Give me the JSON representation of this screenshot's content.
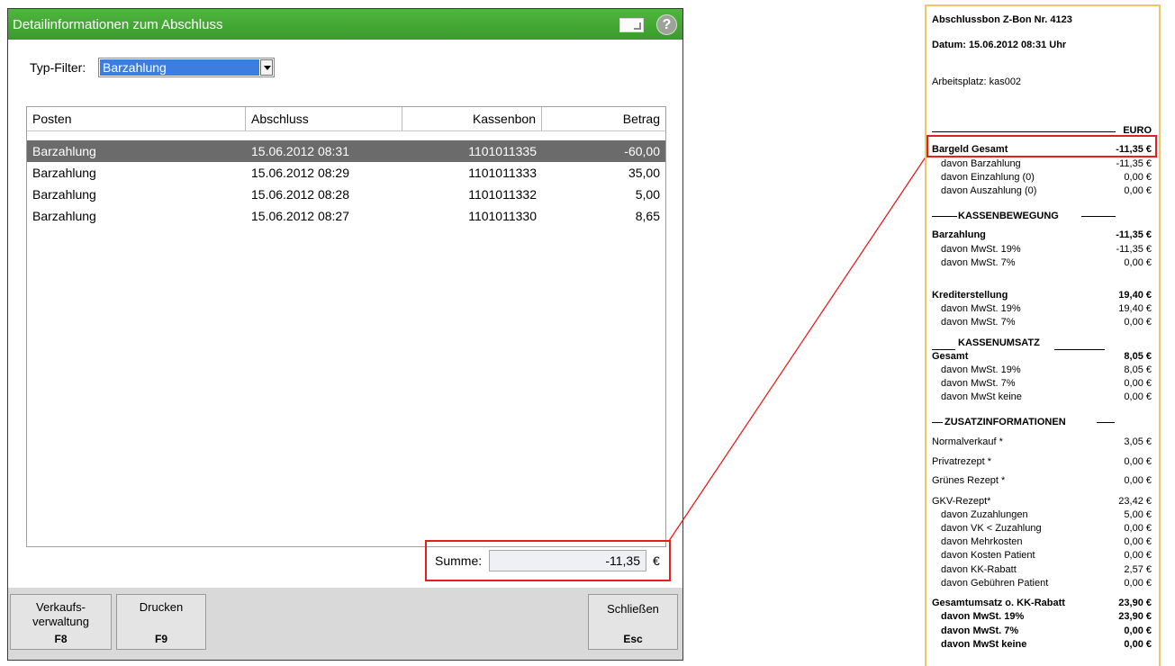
{
  "dialog": {
    "title": "Detailinformationen zum Abschluss",
    "help_icon": "?",
    "filter_label": "Typ-Filter:",
    "filter_value": "Barzahlung",
    "columns": [
      "Posten",
      "Abschluss",
      "Kassenbon",
      "Betrag"
    ],
    "rows": [
      {
        "posten": "Barzahlung",
        "abschluss": "15.06.2012 08:31",
        "kassenbon": "1101011335",
        "betrag": "-60,00"
      },
      {
        "posten": "Barzahlung",
        "abschluss": "15.06.2012 08:29",
        "kassenbon": "1101011333",
        "betrag": "35,00"
      },
      {
        "posten": "Barzahlung",
        "abschluss": "15.06.2012 08:28",
        "kassenbon": "1101011332",
        "betrag": "5,00"
      },
      {
        "posten": "Barzahlung",
        "abschluss": "15.06.2012 08:27",
        "kassenbon": "1101011330",
        "betrag": "8,65"
      }
    ],
    "sum_label": "Summe:",
    "sum_value": "-11,35",
    "sum_currency": "€",
    "buttons": {
      "verkauf_line1": "Verkaufs-",
      "verkauf_line2": "verwaltung",
      "verkauf_key": "F8",
      "drucken": "Drucken",
      "drucken_key": "F9",
      "schliessen": "Schließen",
      "schliessen_key": "Esc"
    }
  },
  "receipt": {
    "title": "Abschlussbon Z-Bon Nr. 4123",
    "datum": "Datum: 15.06.2012  08:31 Uhr",
    "arbeitsplatz": "Arbeitsplatz: kas002",
    "euro": "EURO",
    "bargeld": {
      "label": "Bargeld Gesamt",
      "value": "-11,35 €"
    },
    "bargeld_items": [
      {
        "label": "davon Barzahlung",
        "value": "-11,35 €"
      },
      {
        "label": "davon Einzahlung (0)",
        "value": "0,00 €"
      },
      {
        "label": "davon Auszahlung (0)",
        "value": "0,00 €"
      }
    ],
    "kassenbewegung": "KASSENBEWEGUNG",
    "barzahlung": {
      "label": "Barzahlung",
      "value": "-11,35 €"
    },
    "barzahlung_items": [
      {
        "label": "davon MwSt. 19%",
        "value": "-11,35 €"
      },
      {
        "label": "davon MwSt. 7%",
        "value": "0,00 €"
      }
    ],
    "krediterstellung": {
      "label": "Krediterstellung",
      "value": "19,40 €"
    },
    "kredit_items": [
      {
        "label": "davon MwSt. 19%",
        "value": "19,40 €"
      },
      {
        "label": "davon MwSt. 7%",
        "value": "0,00 €"
      }
    ],
    "kassenumsatz": "KASSENUMSATZ",
    "gesamt": {
      "label": "Gesamt",
      "value": "8,05 €"
    },
    "gesamt_items": [
      {
        "label": "davon MwSt. 19%",
        "value": "8,05 €"
      },
      {
        "label": "davon MwSt. 7%",
        "value": "0,00 €"
      },
      {
        "label": "davon MwSt keine",
        "value": "0,00 €"
      }
    ],
    "zusatz": "ZUSATZINFORMATIONEN",
    "normalverkauf": {
      "label": "Normalverkauf *",
      "value": "3,05 €"
    },
    "privatrezept": {
      "label": "Privatrezept *",
      "value": "0,00 €"
    },
    "gruenes": {
      "label": "Grünes Rezept *",
      "value": "0,00 €"
    },
    "gkv": {
      "label": "GKV-Rezept*",
      "value": "23,42 €"
    },
    "gkv_items": [
      {
        "label": "davon Zuzahlungen",
        "value": "5,00 €"
      },
      {
        "label": "davon VK < Zuzahlung",
        "value": "0,00 €"
      },
      {
        "label": "davon Mehrkosten",
        "value": "0,00 €"
      },
      {
        "label": "davon Kosten Patient",
        "value": "0,00 €"
      },
      {
        "label": "davon KK-Rabatt",
        "value": "2,57 €"
      },
      {
        "label": "davon Gebühren Patient",
        "value": "0,00 €"
      }
    ],
    "gesamtumsatz": {
      "label": "Gesamtumsatz o. KK-Rabatt",
      "value": "23,90 €"
    },
    "gesamtumsatz_items": [
      {
        "label": "davon MwSt. 19%",
        "value": "23,90 €"
      },
      {
        "label": "davon MwSt. 7%",
        "value": "0,00 €"
      },
      {
        "label": "davon MwSt keine",
        "value": "0,00 €"
      }
    ]
  }
}
